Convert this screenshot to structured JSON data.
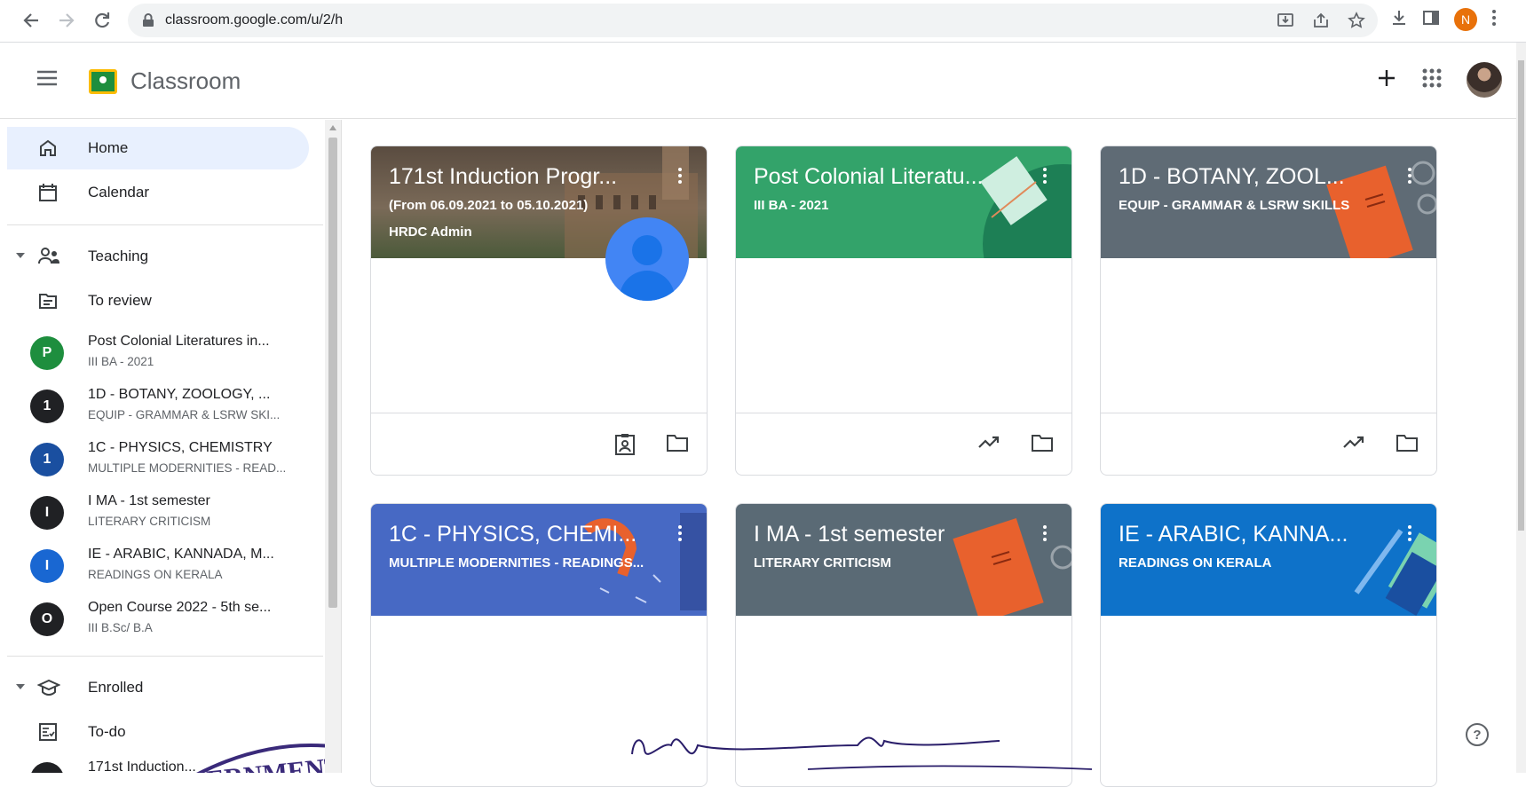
{
  "browser": {
    "url": "classroom.google.com/u/2/h",
    "profile_initial": "N"
  },
  "app": {
    "title": "Classroom"
  },
  "sidebar": {
    "home": "Home",
    "calendar": "Calendar",
    "teaching": "Teaching",
    "to_review": "To review",
    "classes": [
      {
        "initial": "P",
        "name": "Post Colonial Literatures in...",
        "section": "III BA - 2021",
        "color": "#1e8e3e"
      },
      {
        "initial": "1",
        "name": "1D - BOTANY, ZOOLOGY, ...",
        "section": "EQUIP - GRAMMAR & LSRW SKI...",
        "color": "#202124"
      },
      {
        "initial": "1",
        "name": "1C - PHYSICS, CHEMISTRY",
        "section": "MULTIPLE MODERNITIES - READ...",
        "color": "#1a4fa0"
      },
      {
        "initial": "I",
        "name": "I MA - 1st semester",
        "section": "LITERARY CRITICISM",
        "color": "#202124"
      },
      {
        "initial": "I",
        "name": "IE - ARABIC, KANNADA, M...",
        "section": "READINGS ON KERALA",
        "color": "#1967d2"
      },
      {
        "initial": "O",
        "name": "Open Course 2022 - 5th se...",
        "section": "III B.Sc/ B.A",
        "color": "#202124"
      }
    ],
    "enrolled": "Enrolled",
    "todo": "To-do",
    "partial": "171st Induction..."
  },
  "cards": [
    {
      "title": "171st Induction Progr...",
      "subtitle": "(From 06.09.2021 to 05.10.2021)",
      "teacher": "HRDC Admin",
      "color": "#6d5a4a"
    },
    {
      "title": "Post Colonial Literatu...",
      "subtitle": "III BA - 2021",
      "teacher": "",
      "color": "#33a36a"
    },
    {
      "title": "1D - BOTANY, ZOOL...",
      "subtitle": "EQUIP - GRAMMAR & LSRW SKILLS",
      "teacher": "",
      "color": "#5f6b75"
    },
    {
      "title": "1C - PHYSICS, CHEMI...",
      "subtitle": "MULTIPLE MODERNITIES - READINGS...",
      "teacher": "",
      "color": "#4769c4"
    },
    {
      "title": "I MA - 1st semester",
      "subtitle": "LITERARY CRITICISM",
      "teacher": "",
      "color": "#5a6a75"
    },
    {
      "title": "IE - ARABIC, KANNA...",
      "subtitle": "READINGS ON KERALA",
      "teacher": "",
      "color": "#0e72c9"
    }
  ],
  "stamp": {
    "text": "ERNMENT COLL"
  },
  "help": "?"
}
